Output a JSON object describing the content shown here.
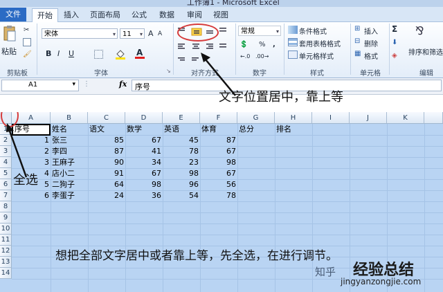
{
  "window": {
    "title": "工作簿1 - Microsoft Excel"
  },
  "tabs": [
    "文件",
    "开始",
    "插入",
    "页面布局",
    "公式",
    "数据",
    "审阅",
    "视图"
  ],
  "ribbon": {
    "clipboard": {
      "paste": "粘贴",
      "label": "剪贴板"
    },
    "font": {
      "name": "宋体",
      "size": "11",
      "bold": "B",
      "italic": "I",
      "underline": "U",
      "grow": "A",
      "shrink": "A",
      "color_letter": "A",
      "label": "字体"
    },
    "alignment": {
      "label": "对齐方式"
    },
    "number": {
      "format": "常规",
      "percent": "%",
      "comma": ",",
      "label": "数字"
    },
    "styles": {
      "conditional": "条件格式",
      "table": "套用表格格式",
      "cell_styles": "单元格样式",
      "label": "样式"
    },
    "cells": {
      "insert": "插入",
      "delete": "删除",
      "format": "格式",
      "label": "单元格"
    },
    "editing": {
      "sum": "Σ",
      "sort": "排序和筛选",
      "label": "编辑"
    }
  },
  "formula_bar": {
    "name_box": "A1",
    "fx": "fx",
    "content": "序号"
  },
  "columns": [
    "A",
    "B",
    "C",
    "D",
    "E",
    "F",
    "G",
    "H",
    "I",
    "J",
    "K"
  ],
  "rows": [
    "1",
    "2",
    "3",
    "4",
    "5",
    "6",
    "7",
    "8",
    "9",
    "10",
    "11",
    "12",
    "13",
    "14"
  ],
  "sheet": {
    "headers": [
      "序号",
      "姓名",
      "语文",
      "数学",
      "英语",
      "体育",
      "总分",
      "排名"
    ],
    "data": [
      [
        "1",
        "张三",
        "85",
        "67",
        "45",
        "87"
      ],
      [
        "2",
        "李四",
        "87",
        "41",
        "78",
        "67"
      ],
      [
        "3",
        "王麻子",
        "90",
        "34",
        "23",
        "98"
      ],
      [
        "4",
        "店小二",
        "91",
        "67",
        "98",
        "67"
      ],
      [
        "5",
        "二狗子",
        "64",
        "98",
        "96",
        "56"
      ],
      [
        "6",
        "李蛋子",
        "24",
        "36",
        "54",
        "78"
      ]
    ]
  },
  "annotations": {
    "align_note": "文字位置居中，靠上等",
    "select_all": "全选",
    "instruction": "想把全部文字居中或者靠上等，先全选，在进行调节。",
    "watermark_zhihu": "知乎",
    "watermark_brand": "经验总结",
    "watermark_url": "jingyanzongjie.com"
  },
  "colors": {
    "highlight_red": "#d63b3b",
    "selection_blue": "#b9d4f3",
    "file_tab": "#2b6bc4"
  }
}
